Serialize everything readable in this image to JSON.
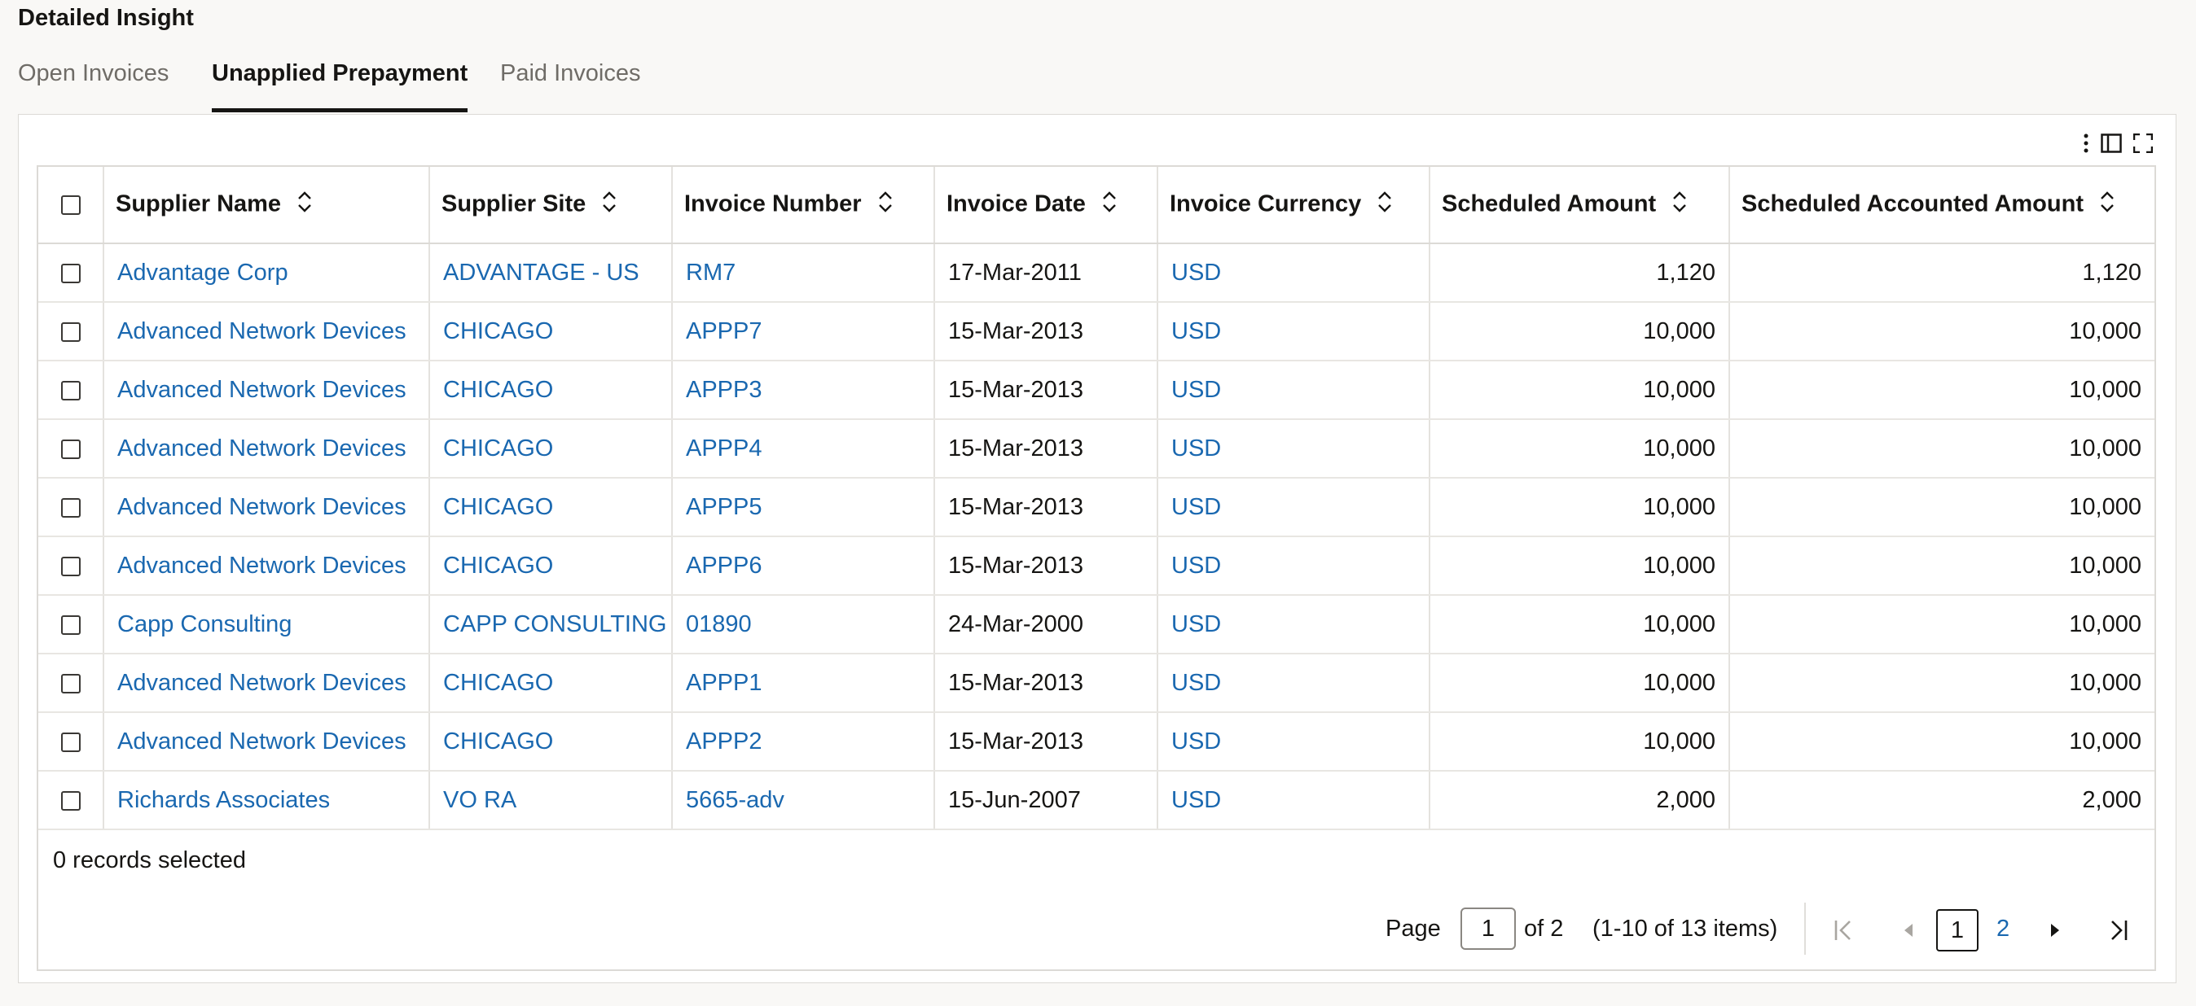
{
  "heading": "Detailed Insight",
  "tabs": [
    {
      "label": "Open Invoices",
      "active": false
    },
    {
      "label": "Unapplied Prepayment",
      "active": true
    },
    {
      "label": "Paid Invoices",
      "active": false
    }
  ],
  "toolbar": {
    "icons": [
      "more-options-icon",
      "column-panel-icon",
      "fullscreen-icon"
    ]
  },
  "columns": [
    "Supplier Name",
    "Supplier Site",
    "Invoice Number",
    "Invoice Date",
    "Invoice Currency",
    "Scheduled Amount",
    "Scheduled Accounted Amount"
  ],
  "rows": [
    {
      "supplier": "Advantage Corp",
      "site": "ADVANTAGE - US",
      "invoice": "RM7",
      "date": "17-Mar-2011",
      "currency": "USD",
      "scheduled": "1,120",
      "accounted": "1,120"
    },
    {
      "supplier": "Advanced Network Devices",
      "site": "CHICAGO",
      "invoice": "APPP7",
      "date": "15-Mar-2013",
      "currency": "USD",
      "scheduled": "10,000",
      "accounted": "10,000"
    },
    {
      "supplier": "Advanced Network Devices",
      "site": "CHICAGO",
      "invoice": "APPP3",
      "date": "15-Mar-2013",
      "currency": "USD",
      "scheduled": "10,000",
      "accounted": "10,000"
    },
    {
      "supplier": "Advanced Network Devices",
      "site": "CHICAGO",
      "invoice": "APPP4",
      "date": "15-Mar-2013",
      "currency": "USD",
      "scheduled": "10,000",
      "accounted": "10,000"
    },
    {
      "supplier": "Advanced Network Devices",
      "site": "CHICAGO",
      "invoice": "APPP5",
      "date": "15-Mar-2013",
      "currency": "USD",
      "scheduled": "10,000",
      "accounted": "10,000"
    },
    {
      "supplier": "Advanced Network Devices",
      "site": "CHICAGO",
      "invoice": "APPP6",
      "date": "15-Mar-2013",
      "currency": "USD",
      "scheduled": "10,000",
      "accounted": "10,000"
    },
    {
      "supplier": "Capp Consulting",
      "site": "CAPP CONSULTING",
      "invoice": "01890",
      "date": "24-Mar-2000",
      "currency": "USD",
      "scheduled": "10,000",
      "accounted": "10,000"
    },
    {
      "supplier": "Advanced Network Devices",
      "site": "CHICAGO",
      "invoice": "APPP1",
      "date": "15-Mar-2013",
      "currency": "USD",
      "scheduled": "10,000",
      "accounted": "10,000"
    },
    {
      "supplier": "Advanced Network Devices",
      "site": "CHICAGO",
      "invoice": "APPP2",
      "date": "15-Mar-2013",
      "currency": "USD",
      "scheduled": "10,000",
      "accounted": "10,000"
    },
    {
      "supplier": "Richards Associates",
      "site": "VO RA",
      "invoice": "5665-adv",
      "date": "15-Jun-2007",
      "currency": "USD",
      "scheduled": "2,000",
      "accounted": "2,000"
    }
  ],
  "records_selected": "0 records selected",
  "pagination": {
    "page_label": "Page",
    "page_value": "1",
    "of_label": "of 2",
    "range_label": "(1-10 of 13 items)",
    "current_page": "1",
    "next_page": "2"
  },
  "colors": {
    "link": "#1a68b0",
    "text": "#161513",
    "muted": "#6f6c67",
    "background": "#f9f8f6"
  }
}
